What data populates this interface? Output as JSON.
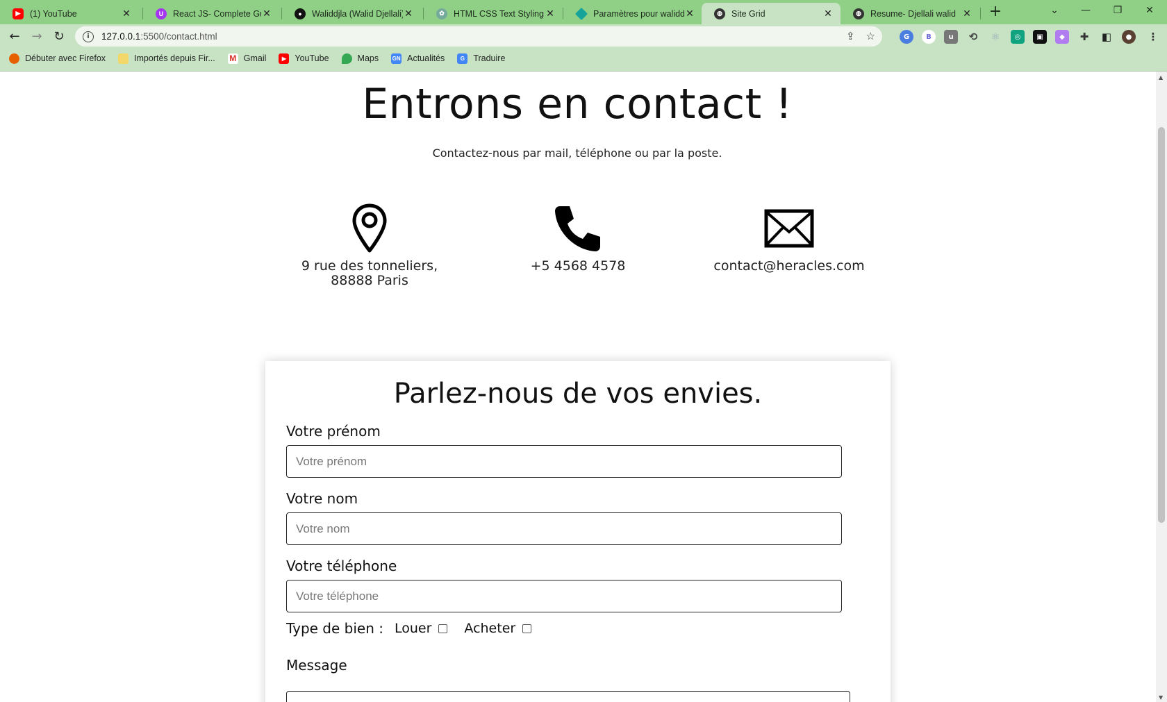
{
  "browser": {
    "tabs": [
      {
        "title": "(1) YouTube",
        "favicon": "youtube-icon",
        "color": "#ff0000"
      },
      {
        "title": "React JS- Complete Guide",
        "favicon": "udemy-icon",
        "color": "#a435f0"
      },
      {
        "title": "Waliddjla (Walid Djellali)",
        "favicon": "github-icon",
        "color": "#111111"
      },
      {
        "title": "HTML CSS Text Styling",
        "favicon": "openai-icon",
        "color": "#74aa9c"
      },
      {
        "title": "Paramètres pour waliddje",
        "favicon": "diamond-icon",
        "color": "#16a39a"
      },
      {
        "title": "Site Grid",
        "favicon": "globe-icon",
        "color": "#333333",
        "active": true
      },
      {
        "title": "Resume- Djellali walid",
        "favicon": "globe-icon",
        "color": "#333333"
      }
    ],
    "url": {
      "host": "127.0.0.1",
      "path": ":5500/contact.html"
    },
    "bookmarks": [
      {
        "label": "Débuter avec Firefox",
        "icon": "firefox-icon",
        "color": "#e66000"
      },
      {
        "label": "Importés depuis Fir...",
        "icon": "folder-icon",
        "color": "#f2d76b"
      },
      {
        "label": "Gmail",
        "icon": "gmail-icon",
        "color": "#d93025"
      },
      {
        "label": "YouTube",
        "icon": "youtube-icon",
        "color": "#ff0000"
      },
      {
        "label": "Maps",
        "icon": "maps-icon",
        "color": "#34a853"
      },
      {
        "label": "Actualités",
        "icon": "news-icon",
        "color": "#4285f4"
      },
      {
        "label": "Traduire",
        "icon": "translate-icon",
        "color": "#4285f4"
      }
    ],
    "accent": "#8fcf86"
  },
  "page": {
    "title": "Entrons en contact !",
    "subtitle": "Contactez-nous par mail, téléphone ou par la poste.",
    "contacts": {
      "address_line1": "9 rue des tonneliers,",
      "address_line2": "88888 Paris",
      "phone": "+5 4568 4578",
      "email": "contact@heracles.com"
    },
    "form": {
      "heading": "Parlez-nous de vos envies.",
      "firstname_label": "Votre prénom",
      "firstname_placeholder": "Votre prénom",
      "lastname_label": "Votre nom",
      "lastname_placeholder": "Votre nom",
      "phone_label": "Votre téléphone",
      "phone_placeholder": "Votre téléphone",
      "type_label": "Type de bien :",
      "option_rent": "Louer",
      "option_buy": "Acheter",
      "message_label": "Message"
    }
  }
}
